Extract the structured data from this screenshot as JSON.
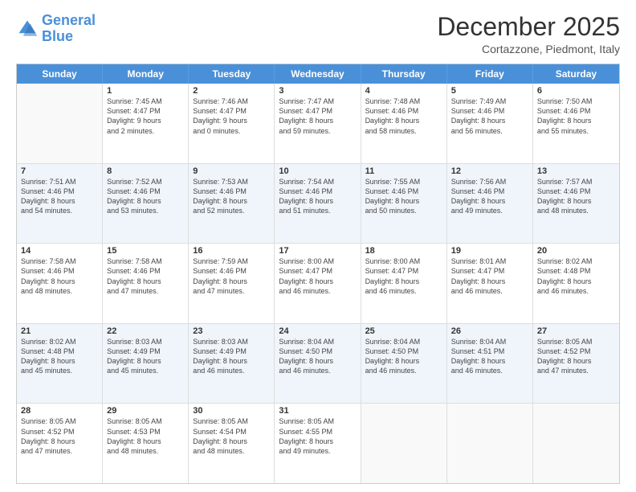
{
  "header": {
    "logo_general": "General",
    "logo_blue": "Blue",
    "month_title": "December 2025",
    "location": "Cortazzone, Piedmont, Italy"
  },
  "days_of_week": [
    "Sunday",
    "Monday",
    "Tuesday",
    "Wednesday",
    "Thursday",
    "Friday",
    "Saturday"
  ],
  "weeks": [
    [
      {
        "num": "",
        "lines": []
      },
      {
        "num": "1",
        "lines": [
          "Sunrise: 7:45 AM",
          "Sunset: 4:47 PM",
          "Daylight: 9 hours",
          "and 2 minutes."
        ]
      },
      {
        "num": "2",
        "lines": [
          "Sunrise: 7:46 AM",
          "Sunset: 4:47 PM",
          "Daylight: 9 hours",
          "and 0 minutes."
        ]
      },
      {
        "num": "3",
        "lines": [
          "Sunrise: 7:47 AM",
          "Sunset: 4:47 PM",
          "Daylight: 8 hours",
          "and 59 minutes."
        ]
      },
      {
        "num": "4",
        "lines": [
          "Sunrise: 7:48 AM",
          "Sunset: 4:46 PM",
          "Daylight: 8 hours",
          "and 58 minutes."
        ]
      },
      {
        "num": "5",
        "lines": [
          "Sunrise: 7:49 AM",
          "Sunset: 4:46 PM",
          "Daylight: 8 hours",
          "and 56 minutes."
        ]
      },
      {
        "num": "6",
        "lines": [
          "Sunrise: 7:50 AM",
          "Sunset: 4:46 PM",
          "Daylight: 8 hours",
          "and 55 minutes."
        ]
      }
    ],
    [
      {
        "num": "7",
        "lines": [
          "Sunrise: 7:51 AM",
          "Sunset: 4:46 PM",
          "Daylight: 8 hours",
          "and 54 minutes."
        ]
      },
      {
        "num": "8",
        "lines": [
          "Sunrise: 7:52 AM",
          "Sunset: 4:46 PM",
          "Daylight: 8 hours",
          "and 53 minutes."
        ]
      },
      {
        "num": "9",
        "lines": [
          "Sunrise: 7:53 AM",
          "Sunset: 4:46 PM",
          "Daylight: 8 hours",
          "and 52 minutes."
        ]
      },
      {
        "num": "10",
        "lines": [
          "Sunrise: 7:54 AM",
          "Sunset: 4:46 PM",
          "Daylight: 8 hours",
          "and 51 minutes."
        ]
      },
      {
        "num": "11",
        "lines": [
          "Sunrise: 7:55 AM",
          "Sunset: 4:46 PM",
          "Daylight: 8 hours",
          "and 50 minutes."
        ]
      },
      {
        "num": "12",
        "lines": [
          "Sunrise: 7:56 AM",
          "Sunset: 4:46 PM",
          "Daylight: 8 hours",
          "and 49 minutes."
        ]
      },
      {
        "num": "13",
        "lines": [
          "Sunrise: 7:57 AM",
          "Sunset: 4:46 PM",
          "Daylight: 8 hours",
          "and 48 minutes."
        ]
      }
    ],
    [
      {
        "num": "14",
        "lines": [
          "Sunrise: 7:58 AM",
          "Sunset: 4:46 PM",
          "Daylight: 8 hours",
          "and 48 minutes."
        ]
      },
      {
        "num": "15",
        "lines": [
          "Sunrise: 7:58 AM",
          "Sunset: 4:46 PM",
          "Daylight: 8 hours",
          "and 47 minutes."
        ]
      },
      {
        "num": "16",
        "lines": [
          "Sunrise: 7:59 AM",
          "Sunset: 4:46 PM",
          "Daylight: 8 hours",
          "and 47 minutes."
        ]
      },
      {
        "num": "17",
        "lines": [
          "Sunrise: 8:00 AM",
          "Sunset: 4:47 PM",
          "Daylight: 8 hours",
          "and 46 minutes."
        ]
      },
      {
        "num": "18",
        "lines": [
          "Sunrise: 8:00 AM",
          "Sunset: 4:47 PM",
          "Daylight: 8 hours",
          "and 46 minutes."
        ]
      },
      {
        "num": "19",
        "lines": [
          "Sunrise: 8:01 AM",
          "Sunset: 4:47 PM",
          "Daylight: 8 hours",
          "and 46 minutes."
        ]
      },
      {
        "num": "20",
        "lines": [
          "Sunrise: 8:02 AM",
          "Sunset: 4:48 PM",
          "Daylight: 8 hours",
          "and 46 minutes."
        ]
      }
    ],
    [
      {
        "num": "21",
        "lines": [
          "Sunrise: 8:02 AM",
          "Sunset: 4:48 PM",
          "Daylight: 8 hours",
          "and 45 minutes."
        ]
      },
      {
        "num": "22",
        "lines": [
          "Sunrise: 8:03 AM",
          "Sunset: 4:49 PM",
          "Daylight: 8 hours",
          "and 45 minutes."
        ]
      },
      {
        "num": "23",
        "lines": [
          "Sunrise: 8:03 AM",
          "Sunset: 4:49 PM",
          "Daylight: 8 hours",
          "and 46 minutes."
        ]
      },
      {
        "num": "24",
        "lines": [
          "Sunrise: 8:04 AM",
          "Sunset: 4:50 PM",
          "Daylight: 8 hours",
          "and 46 minutes."
        ]
      },
      {
        "num": "25",
        "lines": [
          "Sunrise: 8:04 AM",
          "Sunset: 4:50 PM",
          "Daylight: 8 hours",
          "and 46 minutes."
        ]
      },
      {
        "num": "26",
        "lines": [
          "Sunrise: 8:04 AM",
          "Sunset: 4:51 PM",
          "Daylight: 8 hours",
          "and 46 minutes."
        ]
      },
      {
        "num": "27",
        "lines": [
          "Sunrise: 8:05 AM",
          "Sunset: 4:52 PM",
          "Daylight: 8 hours",
          "and 47 minutes."
        ]
      }
    ],
    [
      {
        "num": "28",
        "lines": [
          "Sunrise: 8:05 AM",
          "Sunset: 4:52 PM",
          "Daylight: 8 hours",
          "and 47 minutes."
        ]
      },
      {
        "num": "29",
        "lines": [
          "Sunrise: 8:05 AM",
          "Sunset: 4:53 PM",
          "Daylight: 8 hours",
          "and 48 minutes."
        ]
      },
      {
        "num": "30",
        "lines": [
          "Sunrise: 8:05 AM",
          "Sunset: 4:54 PM",
          "Daylight: 8 hours",
          "and 48 minutes."
        ]
      },
      {
        "num": "31",
        "lines": [
          "Sunrise: 8:05 AM",
          "Sunset: 4:55 PM",
          "Daylight: 8 hours",
          "and 49 minutes."
        ]
      },
      {
        "num": "",
        "lines": []
      },
      {
        "num": "",
        "lines": []
      },
      {
        "num": "",
        "lines": []
      }
    ]
  ]
}
